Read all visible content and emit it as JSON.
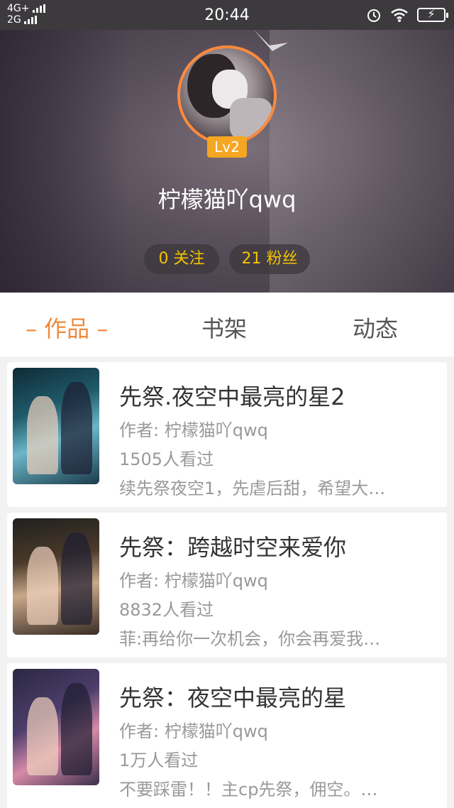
{
  "status_bar": {
    "network_1": "4G+",
    "network_2": "2G",
    "time": "20:44",
    "icons": [
      "signal-icon",
      "alarm-icon",
      "wifi-icon",
      "battery-icon"
    ]
  },
  "profile": {
    "level": "Lv2",
    "username": "柠檬猫吖qwq",
    "follow_label": "0 关注",
    "fans_label": "21 粉丝"
  },
  "tabs": {
    "works": "– 作品 –",
    "shelf": "书架",
    "feed": "动态"
  },
  "books": [
    {
      "title": "先祭.夜空中最亮的星2",
      "author": "作者: 柠檬猫吖qwq",
      "views": "1505人看过",
      "desc": "续先祭夜空1，先虐后甜，希望大…"
    },
    {
      "title": "先祭：跨越时空来爱你",
      "author": "作者: 柠檬猫吖qwq",
      "views": "8832人看过",
      "desc": "菲:再给你一次机会，你会再爱我…"
    },
    {
      "title": "先祭：夜空中最亮的星",
      "author": "作者: 柠檬猫吖qwq",
      "views": "1万人看过",
      "desc": "不要踩雷！！主cp先祭，佣空。…"
    }
  ],
  "colors": {
    "accent": "#f08a3c",
    "level_badge": "#f5a623",
    "stat_text": "#f5c400"
  }
}
